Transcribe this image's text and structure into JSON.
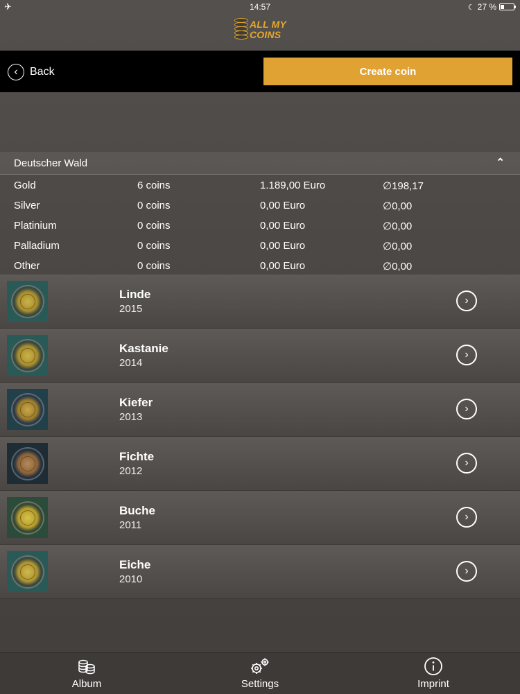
{
  "status": {
    "time": "14:57",
    "battery_text": "27 %",
    "battery_level": 0.27
  },
  "logo": {
    "line1": "ALL MY",
    "line2": "COINS"
  },
  "toolbar": {
    "back_label": "Back",
    "create_label": "Create coin"
  },
  "section": {
    "title": "Deutscher Wald",
    "stats": [
      {
        "metal": "Gold",
        "coins": "6 coins",
        "value": "1.189,00 Euro",
        "avg": "∅198,17"
      },
      {
        "metal": "Silver",
        "coins": "0 coins",
        "value": "0,00 Euro",
        "avg": "∅0,00"
      },
      {
        "metal": "Platinium",
        "coins": "0 coins",
        "value": "0,00 Euro",
        "avg": "∅0,00"
      },
      {
        "metal": "Palladium",
        "coins": "0 coins",
        "value": "0,00 Euro",
        "avg": "∅0,00"
      },
      {
        "metal": "Other",
        "coins": "0 coins",
        "value": "0,00 Euro",
        "avg": "∅0,00"
      }
    ]
  },
  "coins": [
    {
      "name": "Linde",
      "year": "2015"
    },
    {
      "name": "Kastanie",
      "year": "2014"
    },
    {
      "name": "Kiefer",
      "year": "2013"
    },
    {
      "name": "Fichte",
      "year": "2012"
    },
    {
      "name": "Buche",
      "year": "2011"
    },
    {
      "name": "Eiche",
      "year": "2010"
    }
  ],
  "tabs": [
    {
      "label": "Album",
      "icon": "coins-stack-icon"
    },
    {
      "label": "Settings",
      "icon": "gears-icon"
    },
    {
      "label": "Imprint",
      "icon": "info-icon"
    }
  ],
  "colors": {
    "accent": "#e0a233",
    "toolbar": "#000000"
  }
}
